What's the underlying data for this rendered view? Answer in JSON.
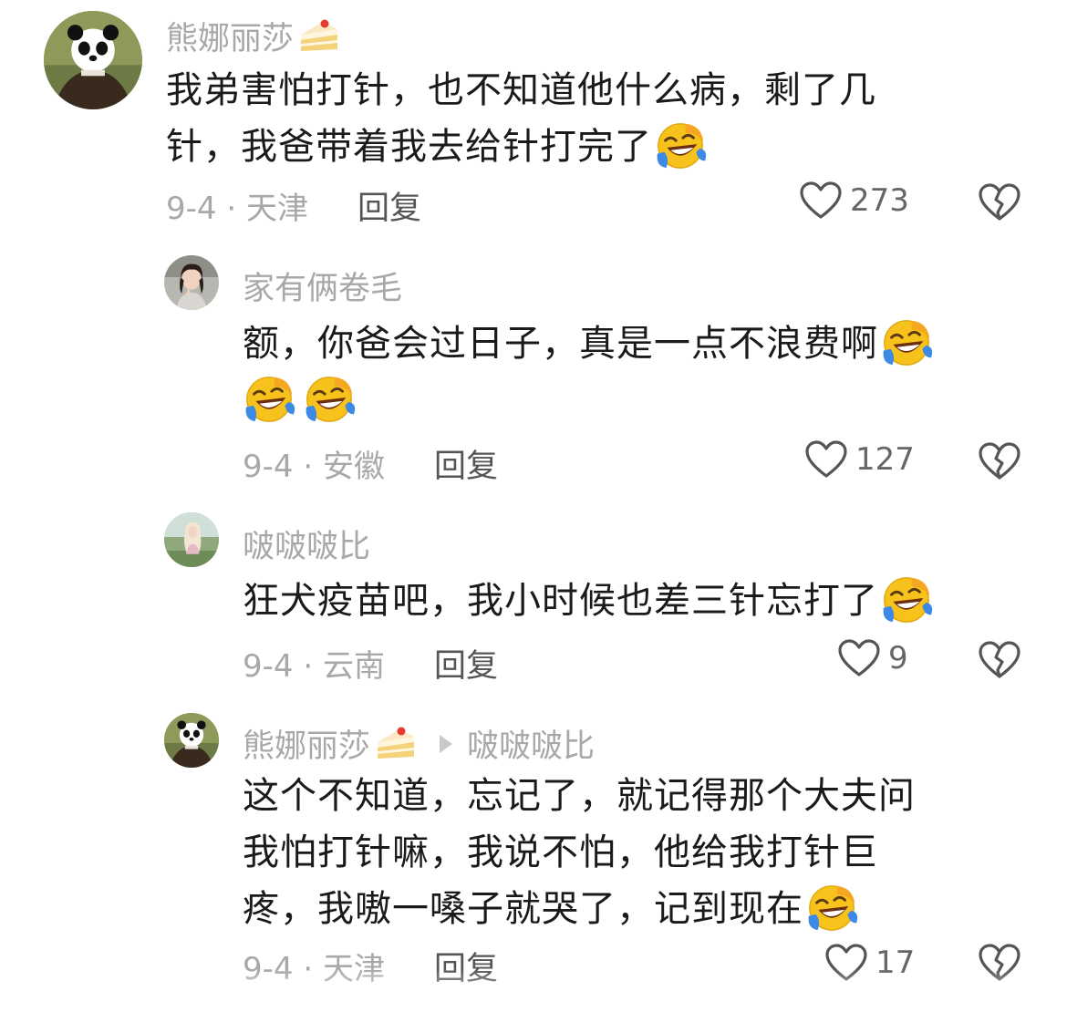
{
  "comments": [
    {
      "author": "熊娜丽莎",
      "text_lines": [
        "我弟害怕打针，也不知道他什么病，剩了几",
        "针，我爸带着我去给针打完了"
      ],
      "date_location": "9-4 · 天津",
      "reply_label": "回复",
      "likes": "273",
      "avatar_icon": "panda-avatar-icon"
    },
    {
      "author": "家有俩卷毛",
      "text_lines": [
        "额，你爸会过日子，真是一点不浪费啊",
        ""
      ],
      "date_location": "9-4 · 安徽",
      "reply_label": "回复",
      "likes": "127",
      "avatar_icon": "woman-avatar-icon"
    },
    {
      "author": "啵啵啵比",
      "text_lines": [
        "狂犬疫苗吧，我小时候也差三针忘打了"
      ],
      "date_location": "9-4 · 云南",
      "reply_label": "回复",
      "likes": "9",
      "avatar_icon": "girl-avatar-icon"
    },
    {
      "author": "熊娜丽莎",
      "reply_to": "啵啵啵比",
      "text_lines": [
        "这个不知道，忘记了，就记得那个大夫问",
        "我怕打针嘛，我说不怕，他给我打针巨",
        "疼，我嗷一嗓子就哭了，记到现在"
      ],
      "date_location": "9-4 · 天津",
      "reply_label": "回复",
      "likes": "17",
      "avatar_icon": "panda-avatar-icon"
    }
  ],
  "colors": {
    "meta_gray": "#a8a8a8",
    "text": "#1a1a1a",
    "emoji_yellow": "#f7c21b",
    "tear_blue": "#3d8ae6"
  }
}
